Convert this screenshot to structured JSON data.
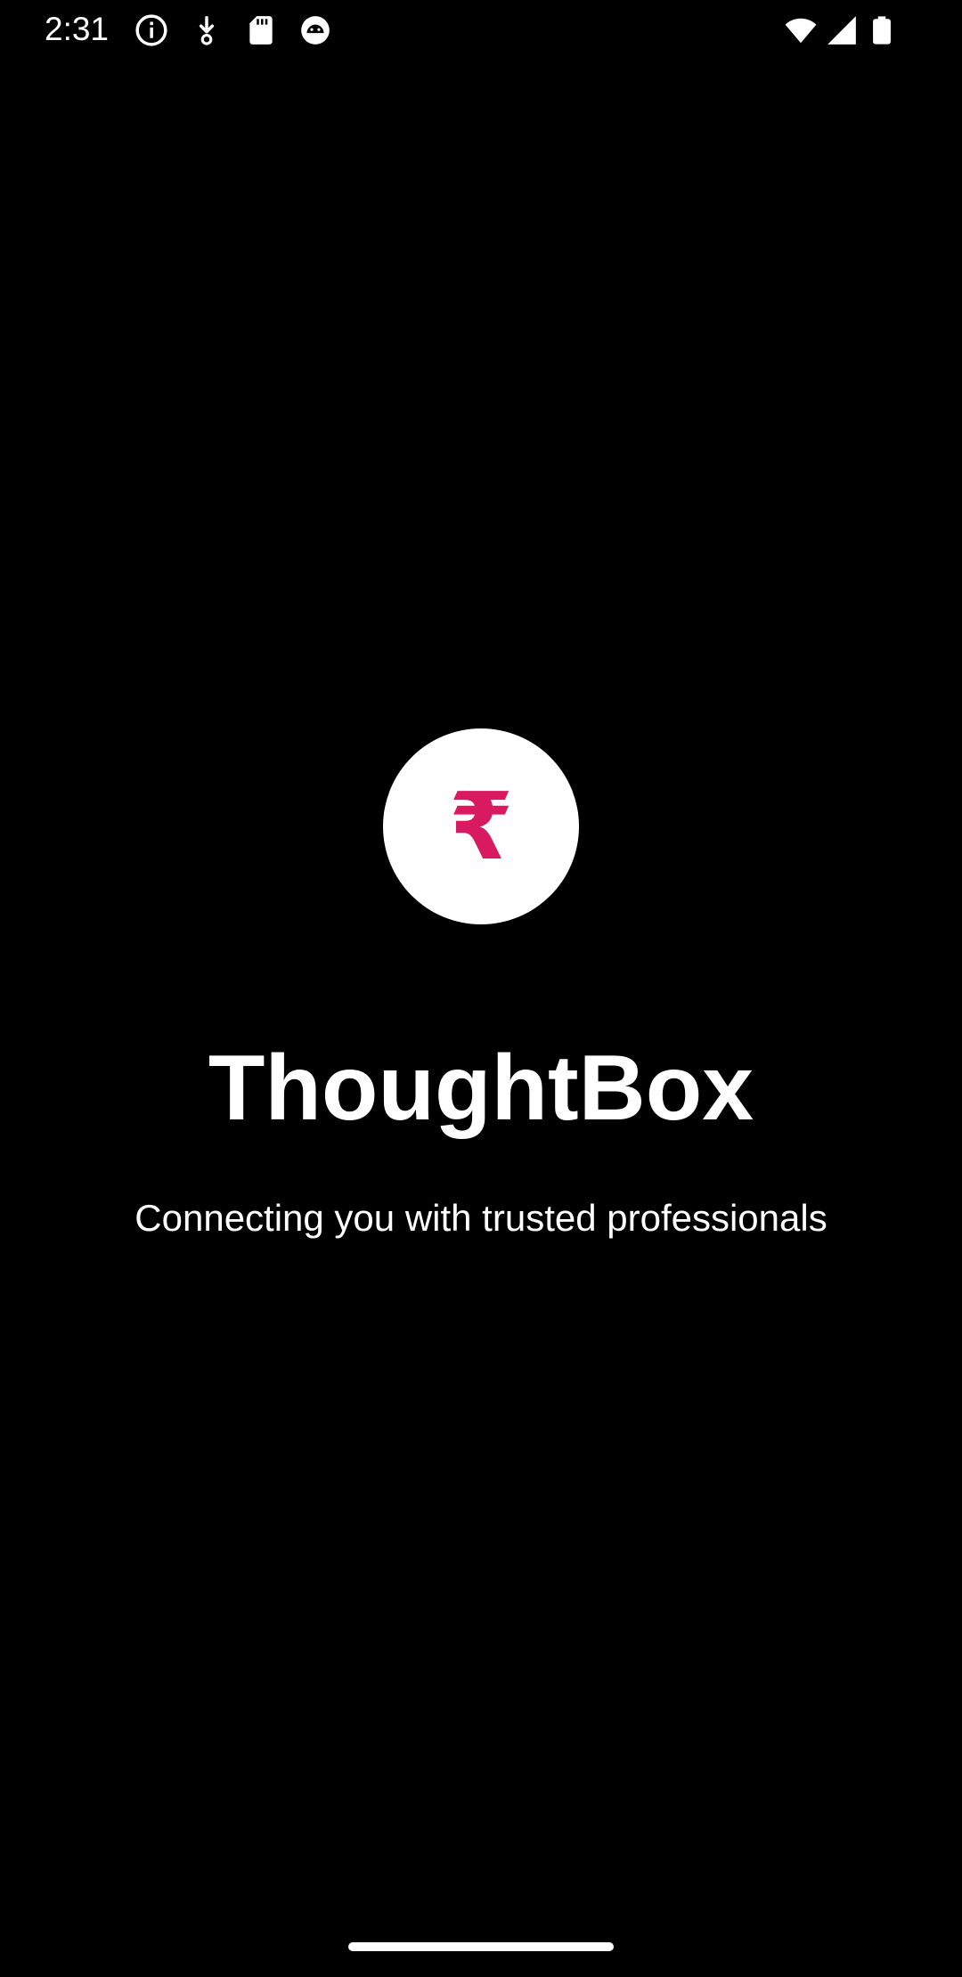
{
  "status_bar": {
    "time": "2:31",
    "icons": [
      "info-icon",
      "download-icon",
      "sd-card-icon",
      "android-icon",
      "wifi-icon",
      "signal-icon",
      "battery-icon"
    ]
  },
  "splash": {
    "logo_symbol": "₹",
    "logo_icon": "rupee-icon",
    "title": "ThoughtBox",
    "subtitle": "Connecting you with trusted professionals"
  },
  "colors": {
    "background": "#000000",
    "accent": "#d81b60",
    "text": "#ffffff"
  }
}
